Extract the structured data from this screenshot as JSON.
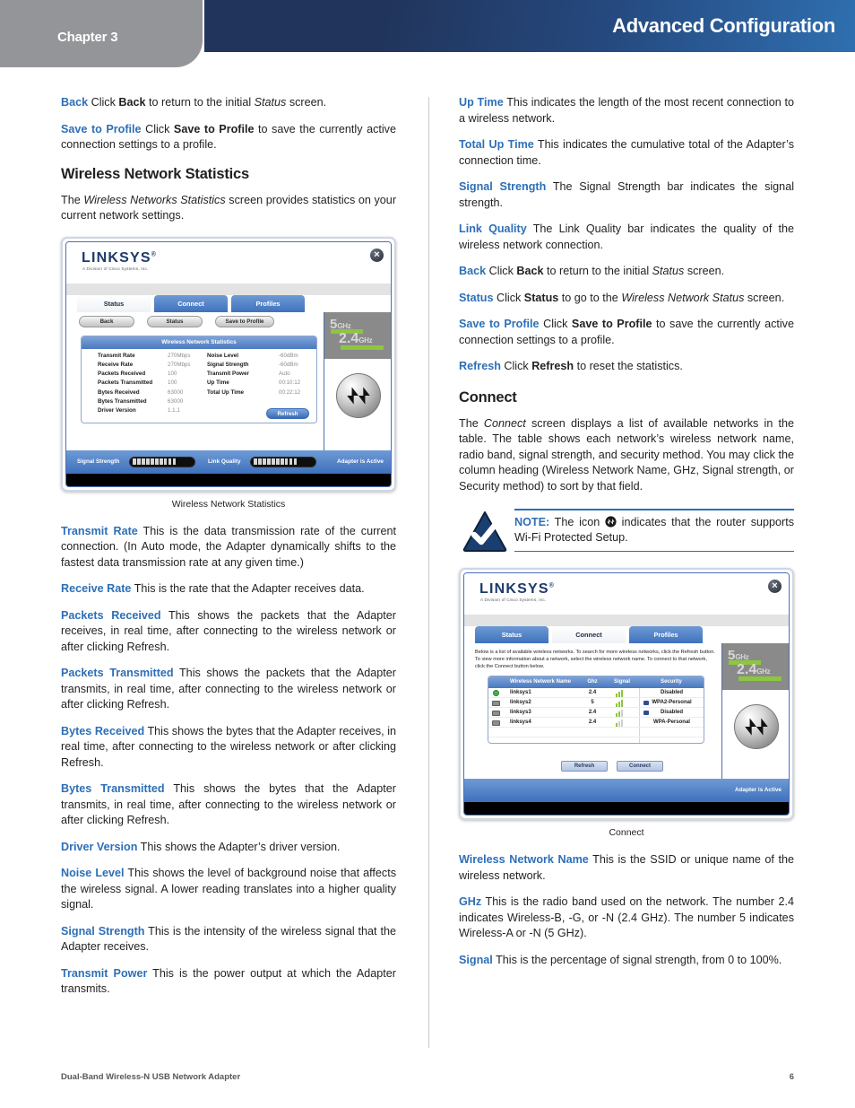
{
  "header": {
    "chapter": "Chapter 3",
    "title": "Advanced Configuration"
  },
  "left_column": {
    "paragraphs": [
      {
        "term": "Back",
        "text": " Click ",
        "bold1": "Back",
        "text2": " to return to the initial ",
        "ital": "Status",
        "text3": " screen."
      },
      {
        "term": "Save to Profile",
        "text": "  Click ",
        "bold1": "Save to Profile",
        "text2": " to save the currently active connection settings to a profile."
      }
    ],
    "heading": "Wireless Network Statistics",
    "intro_pre": "The ",
    "intro_ital": "Wireless Networks Statistics",
    "intro_post": " screen provides statistics on your current network settings.",
    "figure_caption": "Wireless Network Statistics",
    "definitions": [
      {
        "term": "Transmit Rate",
        "body": "  This is the data transmission rate of the current connection. (In Auto mode, the Adapter dynamically shifts to the fastest data transmission rate at any given time.)"
      },
      {
        "term": "Receive Rate",
        "body": " This is the rate that the Adapter receives data."
      },
      {
        "term": "Packets Received",
        "body": " This shows the packets that the Adapter receives, in real time, after connecting to the wireless network or after clicking Refresh."
      },
      {
        "term": "Packets Transmitted",
        "body": " This shows the packets that the Adapter transmits, in real time, after connecting to the wireless network or after clicking Refresh."
      },
      {
        "term": "Bytes Received",
        "body": "  This shows the bytes that the Adapter receives, in real time, after connecting to the wireless network or after clicking Refresh."
      },
      {
        "term": "Bytes Transmitted",
        "body": "  This shows the bytes that the Adapter transmits, in real time, after connecting to the wireless network or after clicking Refresh."
      },
      {
        "term": "Driver Version",
        "body": "  This shows the Adapter’s driver version."
      },
      {
        "term": "Noise Level",
        "body": "  This shows the level of background noise that affects the wireless signal. A lower reading translates into a higher quality signal."
      },
      {
        "term": "Signal Strength",
        "body": "  This is the intensity of the wireless signal that the Adapter receives."
      },
      {
        "term": "Transmit Power",
        "body": "  This is the power output at which the Adapter transmits."
      }
    ]
  },
  "right_column": {
    "definitions_top": [
      {
        "term": "Up Time",
        "body": "  This indicates the length of the most recent connection to a wireless network."
      },
      {
        "term": "Total Up Time",
        "body": " This indicates the cumulative total of the Adapter’s connection time."
      },
      {
        "term": "Signal Strength",
        "body": "  The Signal Strength bar indicates the signal strength."
      },
      {
        "term": "Link Quality",
        "body": "  The Link Quality bar indicates the quality of the wireless network connection."
      }
    ],
    "back_para": {
      "term": "Back",
      "text": " Click ",
      "bold1": "Back",
      "text2": " to return to the initial ",
      "ital": "Status",
      "text3": " screen."
    },
    "status_para": {
      "term": "Status",
      "text": " Click ",
      "bold1": "Status",
      "text2": " to go to the ",
      "ital": "Wireless Network Status",
      "text3": " screen."
    },
    "save_para": {
      "term": "Save to Profile",
      "text": "  Click ",
      "bold1": "Save to Profile",
      "text2": " to save the currently active connection settings to a profile."
    },
    "refresh_para": {
      "term": "Refresh",
      "text": "  Click ",
      "bold1": "Refresh",
      "text2": " to reset the statistics."
    },
    "heading_connect": "Connect",
    "connect_intro_pre": "The ",
    "connect_intro_ital": "Connect",
    "connect_intro_post": " screen displays a list of available networks in the table. The table shows each network’s wireless network name, radio band, signal strength, and security method. You may click the column heading (Wireless Network Name, GHz, Signal strength, or Security method) to sort by that field.",
    "note": {
      "label": "NOTE:",
      "text_before": " The icon ",
      "text_after": " indicates that the router supports Wi-Fi Protected Setup."
    },
    "figure_caption": "Connect",
    "definitions_bottom": [
      {
        "term": "Wireless Network Name",
        "body": "   This is the SSID or unique name of the wireless network."
      },
      {
        "term": "GHz",
        "body": " This is the radio band used on the network. The number 2.4 indicates Wireless-B, -G, or -N (2.4 GHz). The number 5 indicates Wireless-A or -N (5 GHz)."
      },
      {
        "term": "Signal",
        "body": "  This is the percentage of signal strength, from 0 to 100%."
      }
    ]
  },
  "status_screenshot": {
    "brand": "LINKSYS",
    "brand_sup": "®",
    "brand_sub": "A Division of Cisco Systems, Inc.",
    "close_icon": "close-icon",
    "tabs": [
      "Status",
      "Connect",
      "Profiles"
    ],
    "active_tab": "Status",
    "buttons": [
      "Back",
      "Status",
      "Save to Profile"
    ],
    "stats_title": "Wireless Network Statistics",
    "stats_left": [
      {
        "label": "Transmit Rate",
        "value": "270Mbps"
      },
      {
        "label": "Receive Rate",
        "value": "270Mbps"
      },
      {
        "label": "Packets Received",
        "value": "100"
      },
      {
        "label": "Packets Transmitted",
        "value": "100"
      },
      {
        "label": "Bytes Received",
        "value": "63000"
      },
      {
        "label": "Bytes Transmitted",
        "value": "63000"
      },
      {
        "label": "Driver Version",
        "value": "1.1.1"
      }
    ],
    "stats_right": [
      {
        "label": "Noise Level",
        "value": "-60dBm"
      },
      {
        "label": "Signal Strength",
        "value": "-60dBm"
      },
      {
        "label": "Transmit Power",
        "value": "Auto"
      },
      {
        "label": "Up Time",
        "value": "00:10:12"
      },
      {
        "label": "Total Up Time",
        "value": "00:22:12"
      }
    ],
    "refresh_label": "Refresh",
    "band_5": {
      "num": "5",
      "unit": "GHz"
    },
    "band_24": {
      "num": "2.4",
      "unit": "GHz"
    },
    "signal_strength_label": "Signal Strength",
    "link_quality_label": "Link Quality",
    "adapter_status": "Adapter is Active"
  },
  "connect_screenshot": {
    "brand": "LINKSYS",
    "brand_sup": "®",
    "brand_sub": "A Division of Cisco Systems, Inc.",
    "close_icon": "close-icon",
    "tabs": [
      "Status",
      "Connect",
      "Profiles"
    ],
    "active_tab": "Connect",
    "description": "Below is a list of available wireless networks. To search for more wireless networks, click the Refresh button. To view more information about a network, select the wireless network name. To connect to that network, click the Connect button below.",
    "table_headers": [
      "Wireless Network Name",
      "Ghz",
      "Signal",
      "Security"
    ],
    "rows": [
      {
        "icon": "check-icon",
        "name": "linksys1",
        "ghz": "2.4",
        "signal_bars": 3,
        "lock": false,
        "security": "Disabled"
      },
      {
        "icon": "computer-icon",
        "name": "linksys2",
        "ghz": "5",
        "signal_bars": 3,
        "lock": true,
        "security": "WPA2-Personal"
      },
      {
        "icon": "computer-icon",
        "name": "linksys3",
        "ghz": "2.4",
        "signal_bars": 2,
        "lock": true,
        "security": "Disabled"
      },
      {
        "icon": "computer-icon",
        "name": "linksys4",
        "ghz": "2.4",
        "signal_bars": 2,
        "lock": false,
        "security": "WPA-Personal"
      }
    ],
    "band_5": {
      "num": "5",
      "unit": "GHz"
    },
    "band_24": {
      "num": "2.4",
      "unit": "GHz"
    },
    "buttons": [
      "Refresh",
      "Connect"
    ],
    "adapter_status": "Adapter is Active"
  },
  "footer": {
    "product": "Dual-Band Wireless-N USB Network Adapter",
    "page": "6"
  }
}
